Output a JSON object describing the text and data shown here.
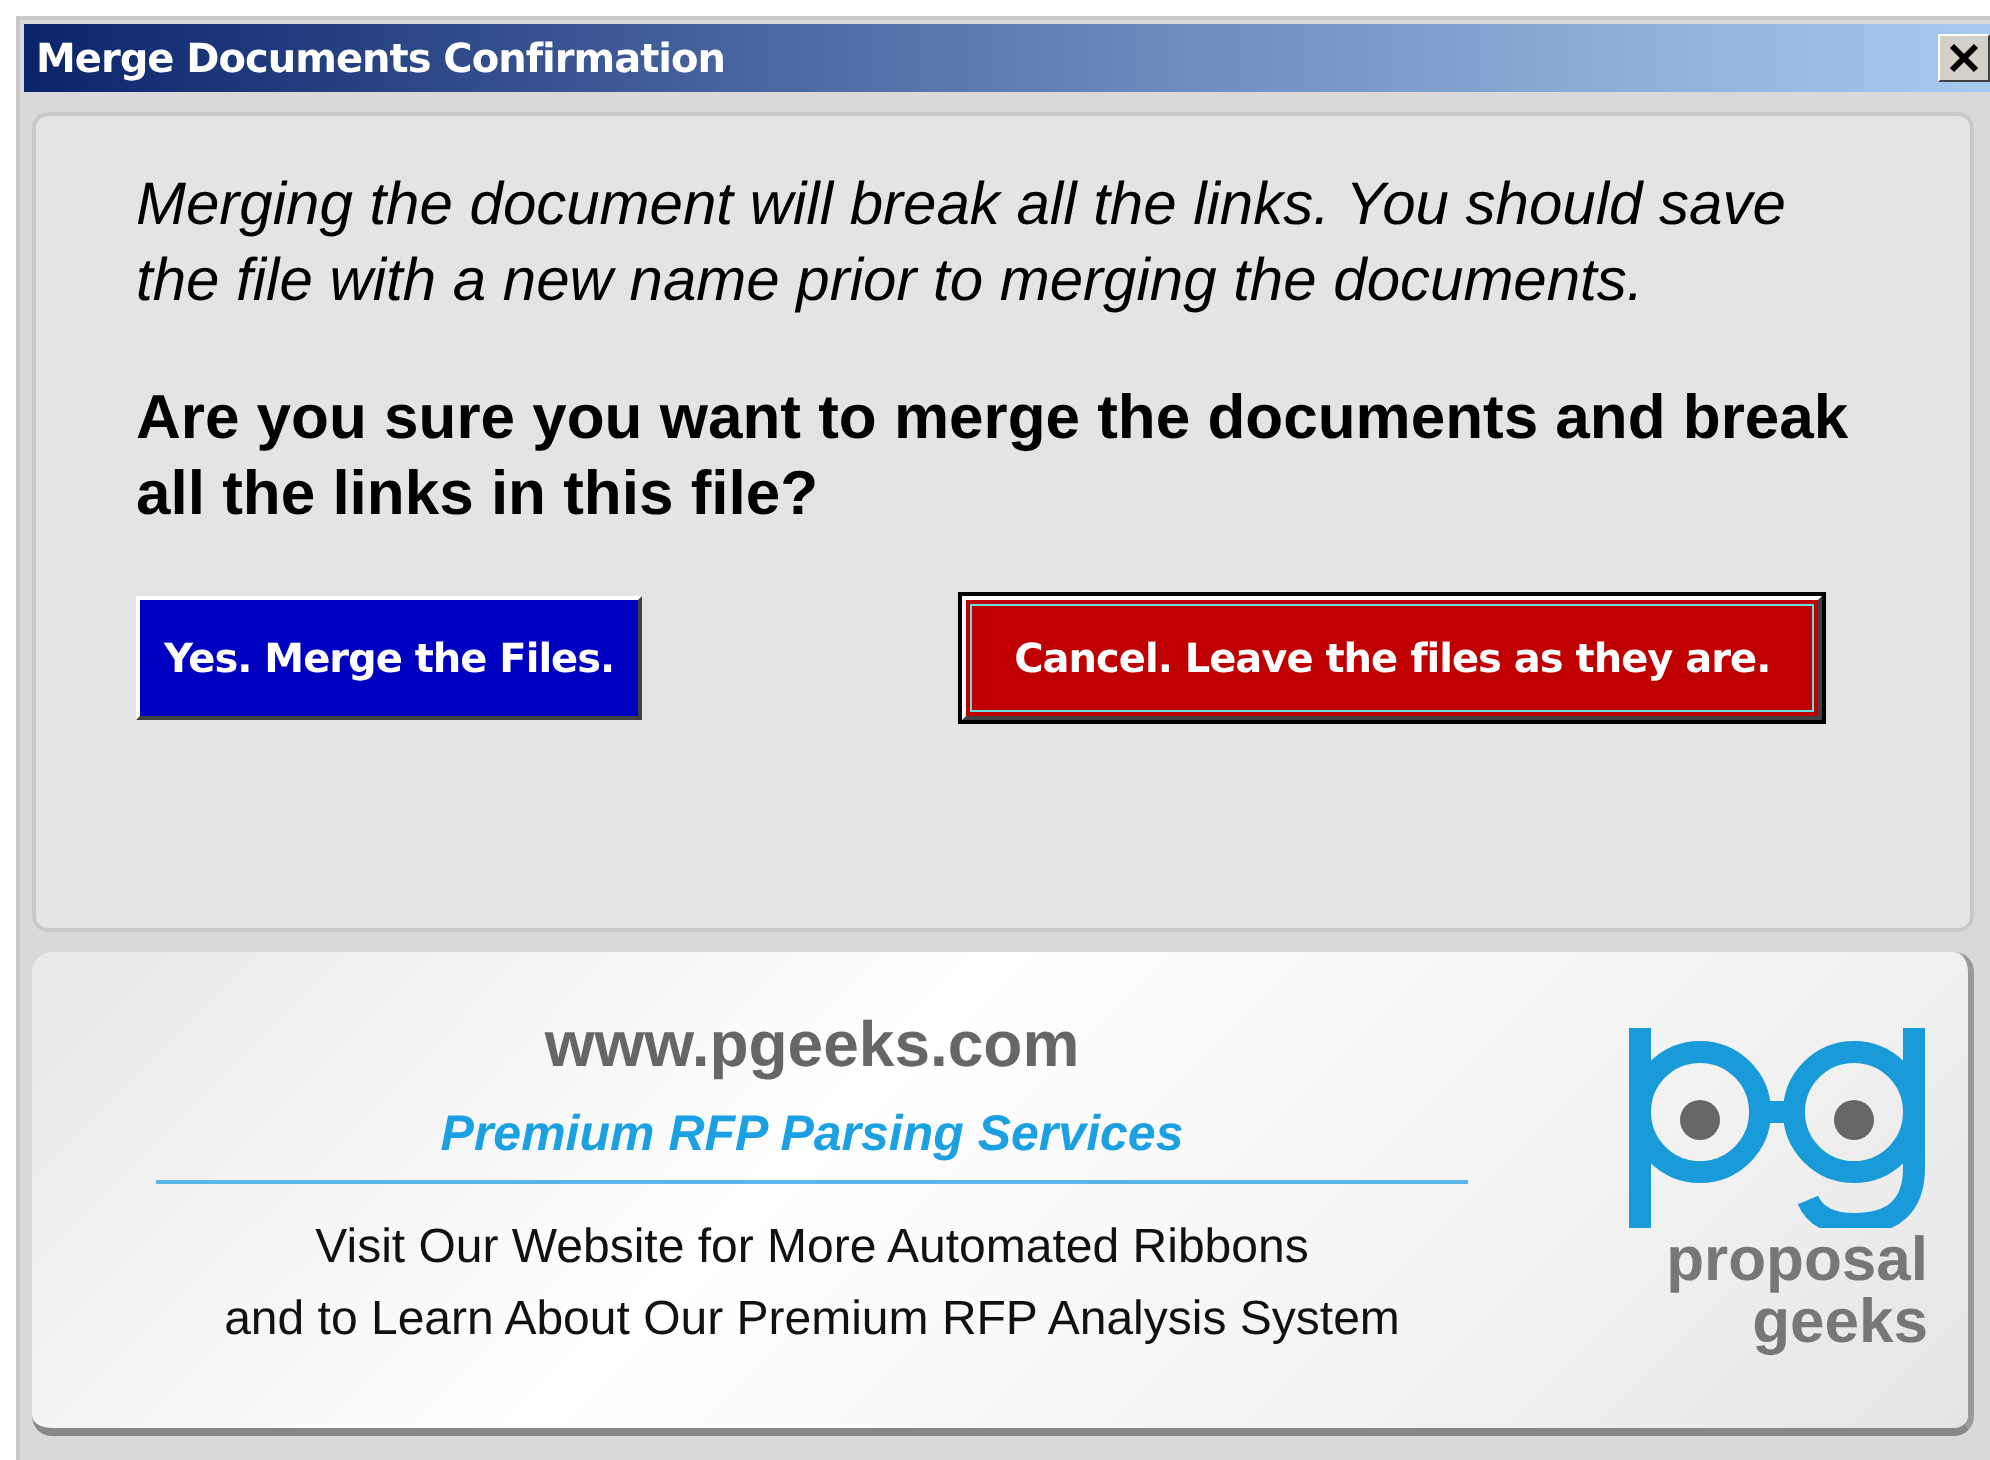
{
  "window": {
    "title": "Merge Documents Confirmation"
  },
  "message": {
    "warning": "Merging the document will break all the links. You should save the file with a new name prior to merging the documents.",
    "question": "Are you sure you want to merge the documents and break all the links in this file?"
  },
  "buttons": [
    {
      "label": "Yes. Merge the Files.",
      "kind": "confirm",
      "focused": false
    },
    {
      "label": "Cancel. Leave the files as they are.",
      "kind": "cancel",
      "focused": true
    }
  ],
  "banner": {
    "url": "www.pgeeks.com",
    "tagline": "Premium RFP Parsing Services",
    "description": [
      "Visit Our Website for More Automated Ribbons",
      "and to Learn About Our Premium RFP Analysis System"
    ],
    "logo": {
      "line_1": "proposal",
      "line_2": "geeks"
    }
  }
}
